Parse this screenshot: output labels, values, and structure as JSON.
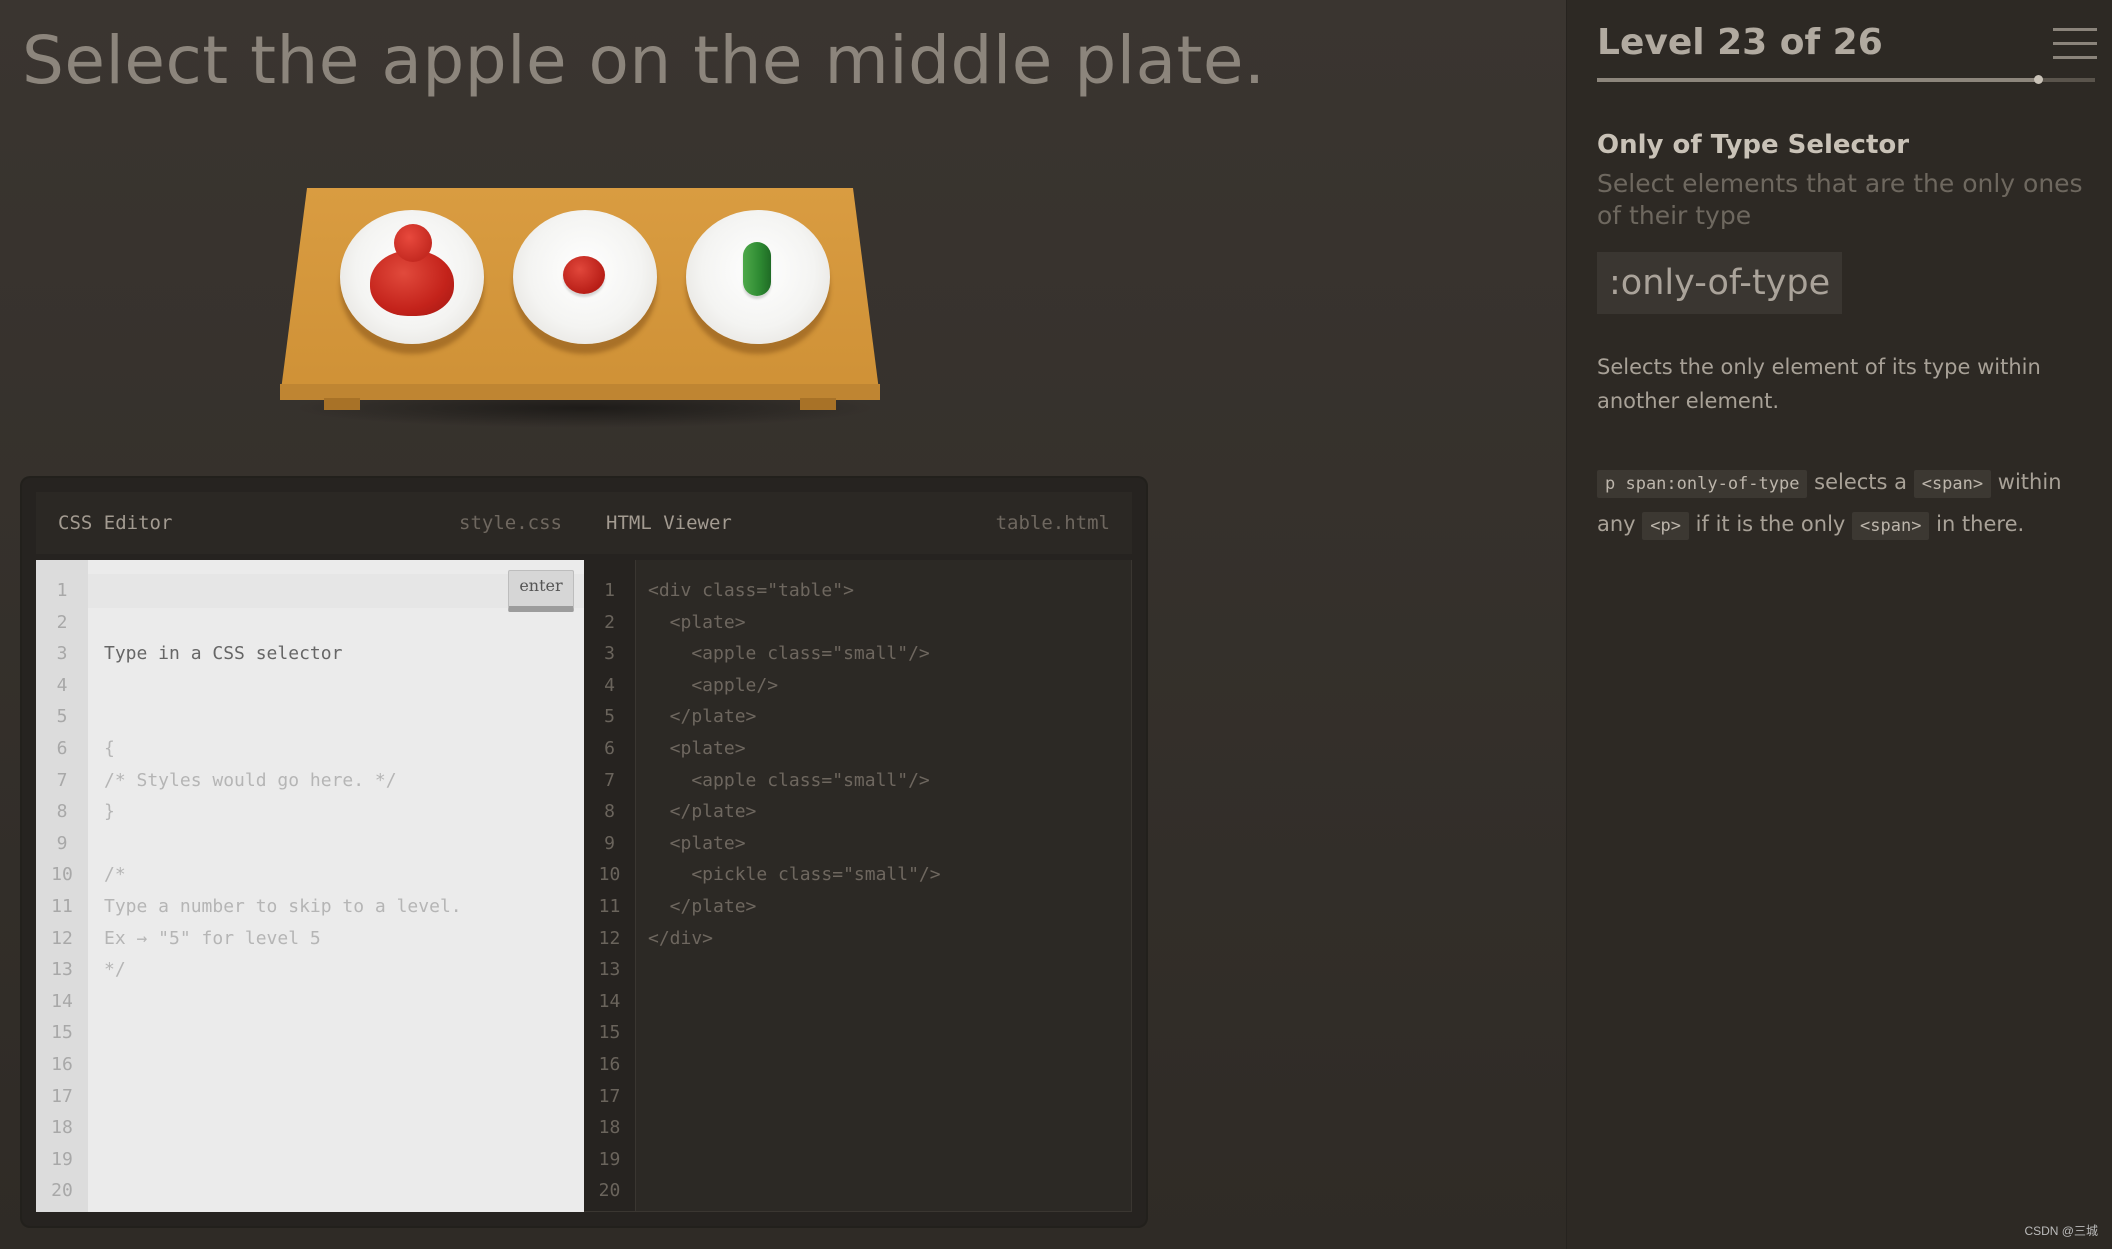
{
  "order": "Select the apple on the middle plate.",
  "editor": {
    "css_title": "CSS Editor",
    "css_file": "style.css",
    "html_title": "HTML Viewer",
    "html_file": "table.html",
    "enter_label": "enter",
    "line_numbers": "1\n2\n3\n4\n5\n6\n7\n8\n9\n10\n11\n12\n13\n14\n15\n16\n17\n18\n19\n20",
    "css_placeholder": "Type in a CSS selector",
    "css_lines": "{\n/* Styles would go here. */\n}\n\n/*\nType a number to skip to a level.\nEx → \"5\" for level 5\n*/",
    "html_lines": "<div class=\"table\">\n  <plate>\n    <apple class=\"small\"/>\n    <apple/>\n  </plate>\n  <plate>\n    <apple class=\"small\"/>\n  </plate>\n  <plate>\n    <pickle class=\"small\"/>\n  </plate>\n</div>"
  },
  "sidebar": {
    "level_title": "Level 23 of 26",
    "progress": 0.885,
    "selector_name": "Only of Type Selector",
    "selector_title": "Select elements that are the only ones of their type",
    "syntax": ":only-of-type",
    "hint": "Selects the only element of its type within another element.",
    "example": {
      "code": "p span:only-of-type",
      "t1": " selects a ",
      "tag1": "<span>",
      "t2": " within any ",
      "tag2": "<p>",
      "t3": " if it is the only ",
      "tag3": "<span>",
      "t4": " in there."
    }
  },
  "watermark": "CSDN @三城"
}
